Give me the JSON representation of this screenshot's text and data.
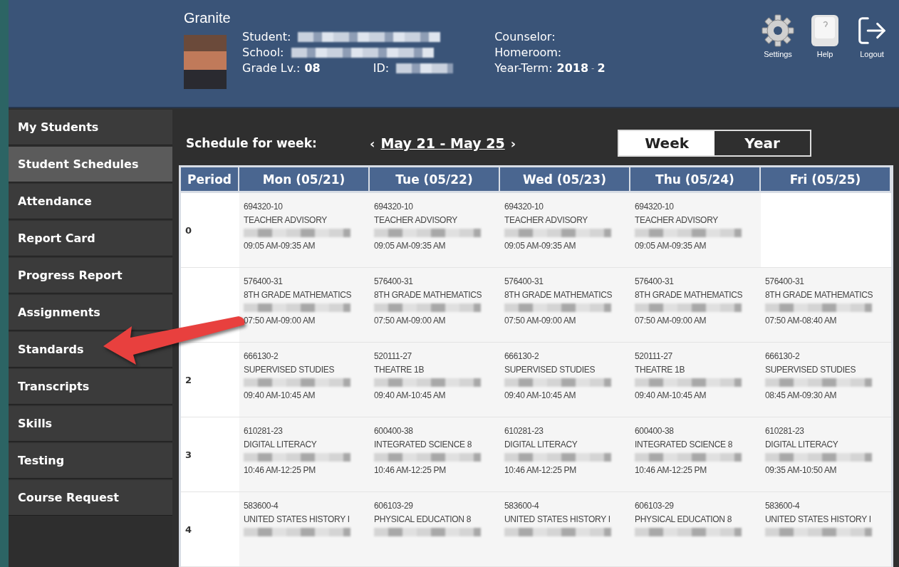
{
  "header": {
    "brand": "Granite",
    "student_fields": [
      {
        "label": "Student:",
        "redacted": true
      },
      {
        "label": "School:",
        "redacted": true
      },
      {
        "label": "Grade Lv.:",
        "value": "08"
      }
    ],
    "id_field": {
      "label": "ID:",
      "redacted": true
    },
    "staff_fields": [
      {
        "label": "Counselor:"
      },
      {
        "label": "Homeroom:"
      },
      {
        "label": "Year-Term:",
        "value": "2018",
        "separator": "-",
        "term": "2"
      }
    ],
    "actions": [
      {
        "label": "Settings",
        "kind": "settings"
      },
      {
        "label": "Help",
        "kind": "help"
      },
      {
        "label": "Logout",
        "kind": "logout"
      }
    ]
  },
  "sidebar": {
    "items": [
      {
        "label": "My Students",
        "selected": false
      },
      {
        "label": "Student Schedules",
        "selected": true
      },
      {
        "label": "Attendance",
        "selected": false
      },
      {
        "label": "Report Card",
        "selected": false
      },
      {
        "label": "Progress Report",
        "selected": false
      },
      {
        "label": "Assignments",
        "selected": false
      },
      {
        "label": "Standards",
        "selected": false
      },
      {
        "label": "Transcripts",
        "selected": false
      },
      {
        "label": "Skills",
        "selected": false
      },
      {
        "label": "Testing",
        "selected": false
      },
      {
        "label": "Course Request",
        "selected": false
      }
    ]
  },
  "schedule": {
    "title": "Schedule for week:",
    "prev": "‹",
    "range": "May 21 - May 25",
    "next": "›",
    "views": [
      {
        "label": "Week",
        "selected": true
      },
      {
        "label": "Year",
        "selected": false
      }
    ],
    "table": {
      "columns": [
        "Period",
        "Mon (05/21)",
        "Tue (05/22)",
        "Wed (05/23)",
        "Thu (05/24)",
        "Fri (05/25)"
      ],
      "rows": [
        [
          "0",
          {
            "code": "694320-10",
            "course": "TEACHER ADVISORY",
            "redacted": true,
            "time": "09:05 AM-09:35 AM"
          },
          {
            "code": "694320-10",
            "course": "TEACHER ADVISORY",
            "redacted": true,
            "time": "09:05 AM-09:35 AM"
          },
          {
            "code": "694320-10",
            "course": "TEACHER ADVISORY",
            "redacted": true,
            "time": "09:05 AM-09:35 AM"
          },
          {
            "code": "694320-10",
            "course": "TEACHER ADVISORY",
            "redacted": true,
            "time": "09:05 AM-09:35 AM"
          },
          ""
        ],
        [
          "",
          {
            "code": "576400-31",
            "course": "8TH GRADE MATHEMATICS",
            "redacted": true,
            "time": "07:50 AM-09:00 AM"
          },
          {
            "code": "576400-31",
            "course": "8TH GRADE MATHEMATICS",
            "redacted": true,
            "time": "07:50 AM-09:00 AM"
          },
          {
            "code": "576400-31",
            "course": "8TH GRADE MATHEMATICS",
            "redacted": true,
            "time": "07:50 AM-09:00 AM"
          },
          {
            "code": "576400-31",
            "course": "8TH GRADE MATHEMATICS",
            "redacted": true,
            "time": "07:50 AM-09:00 AM"
          },
          {
            "code": "576400-31",
            "course": "8TH GRADE MATHEMATICS",
            "redacted": true,
            "time": "07:50 AM-08:40 AM"
          }
        ],
        [
          "2",
          {
            "code": "666130-2",
            "course": "SUPERVISED STUDIES",
            "redacted": true,
            "time": "09:40 AM-10:45 AM"
          },
          {
            "code": "520111-27",
            "course": "THEATRE 1B",
            "redacted": true,
            "time": "09:40 AM-10:45 AM"
          },
          {
            "code": "666130-2",
            "course": "SUPERVISED STUDIES",
            "redacted": true,
            "time": "09:40 AM-10:45 AM"
          },
          {
            "code": "520111-27",
            "course": "THEATRE 1B",
            "redacted": true,
            "time": "09:40 AM-10:45 AM"
          },
          {
            "code": "666130-2",
            "course": "SUPERVISED STUDIES",
            "redacted": true,
            "time": "08:45 AM-09:30 AM"
          }
        ],
        [
          "3",
          {
            "code": "610281-23",
            "course": "DIGITAL LITERACY",
            "redacted": true,
            "time": "10:46 AM-12:25 PM"
          },
          {
            "code": "600400-38",
            "course": "INTEGRATED SCIENCE 8",
            "redacted": true,
            "time": "10:46 AM-12:25 PM"
          },
          {
            "code": "610281-23",
            "course": "DIGITAL LITERACY",
            "redacted": true,
            "time": "10:46 AM-12:25 PM"
          },
          {
            "code": "600400-38",
            "course": "INTEGRATED SCIENCE 8",
            "redacted": true,
            "time": "10:46 AM-12:25 PM"
          },
          {
            "code": "610281-23",
            "course": "DIGITAL LITERACY",
            "redacted": true,
            "time": "09:35 AM-10:50 AM"
          }
        ],
        [
          "4",
          {
            "code": "583600-4",
            "course": "UNITED STATES HISTORY I",
            "redacted": true
          },
          {
            "code": "606103-29",
            "course": "PHYSICAL EDUCATION 8",
            "redacted": true
          },
          {
            "code": "583600-4",
            "course": "UNITED STATES HISTORY I",
            "redacted": true
          },
          {
            "code": "606103-29",
            "course": "PHYSICAL EDUCATION 8",
            "redacted": true
          },
          {
            "code": "583600-4",
            "course": "UNITED STATES HISTORY I",
            "redacted": true
          }
        ]
      ]
    }
  }
}
